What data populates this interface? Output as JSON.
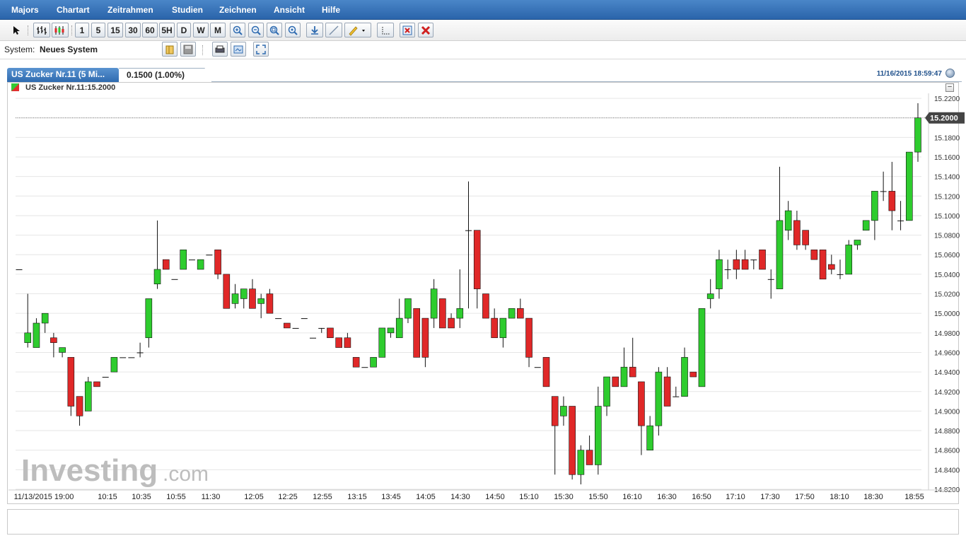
{
  "menu": {
    "items": [
      "Majors",
      "Chartart",
      "Zeitrahmen",
      "Studien",
      "Zeichnen",
      "Ansicht",
      "Hilfe"
    ]
  },
  "toolbar": {
    "timeframes": [
      "1",
      "5",
      "15",
      "30",
      "60",
      "5H",
      "D",
      "W",
      "M"
    ],
    "icons": [
      "pointer-icon",
      "bar-chart-icon",
      "candlestick-icon",
      "zoom-in-icon",
      "zoom-out-icon",
      "zoom-fit-icon",
      "zoom-reset-icon",
      "download-icon",
      "line-draw-icon",
      "pencil-icon",
      "dropdown-icon",
      "crosshair-icon",
      "remove-drawing-icon",
      "delete-icon"
    ]
  },
  "system": {
    "label": "System:",
    "value": "Neues System"
  },
  "tab": {
    "title": "US Zucker Nr.11 (5 Mi...",
    "quote": "0.1500 (1.00%)",
    "datetime": "11/16/2015 18:59:47"
  },
  "legend": "US Zucker Nr.11:15.2000",
  "watermark": {
    "main": "Investing",
    "suffix": ".com"
  },
  "colors": {
    "up": "#2ecc2e",
    "down": "#e02828",
    "accent": "#2f6bb0",
    "label_bg": "#444444"
  },
  "chart_data": {
    "type": "candlestick",
    "title": "US Zucker Nr.11",
    "interval": "5 Min",
    "last_price": "15.2000",
    "y_ticks": [
      "15.2200",
      "15.2000",
      "15.1800",
      "15.1600",
      "15.1400",
      "15.1200",
      "15.1000",
      "15.0800",
      "15.0600",
      "15.0400",
      "15.0200",
      "15.0000",
      "14.9800",
      "14.9600",
      "14.9400",
      "14.9200",
      "14.9000",
      "14.8800",
      "14.8600",
      "14.8400",
      "14.8200"
    ],
    "ylim": [
      14.82,
      15.22
    ],
    "x_ticks": [
      "11/13/2015 19:00",
      "10:15",
      "10:35",
      "10:55",
      "11:30",
      "12:05",
      "12:25",
      "12:55",
      "13:15",
      "13:45",
      "14:05",
      "14:30",
      "14:50",
      "15:10",
      "15:30",
      "15:50",
      "16:10",
      "16:30",
      "16:50",
      "17:10",
      "17:30",
      "17:50",
      "18:10",
      "18:30",
      "18:55"
    ],
    "grid": true,
    "candles": [
      [
        15.045,
        15.045,
        15.045,
        15.045
      ],
      [
        14.97,
        15.02,
        14.965,
        14.98
      ],
      [
        14.965,
        14.995,
        14.965,
        14.99
      ],
      [
        14.99,
        15.0,
        14.98,
        15.0
      ],
      [
        14.975,
        14.98,
        14.955,
        14.97
      ],
      [
        14.96,
        14.965,
        14.955,
        14.965
      ],
      [
        14.955,
        14.955,
        14.895,
        14.905
      ],
      [
        14.915,
        14.915,
        14.885,
        14.895
      ],
      [
        14.9,
        14.935,
        14.9,
        14.93
      ],
      [
        14.93,
        14.93,
        14.925,
        14.925
      ],
      [
        14.935,
        14.935,
        14.935,
        14.935
      ],
      [
        14.94,
        14.955,
        14.94,
        14.955
      ],
      [
        14.955,
        14.955,
        14.955,
        14.955
      ],
      [
        14.955,
        14.955,
        14.955,
        14.955
      ],
      [
        14.96,
        14.97,
        14.955,
        14.96
      ],
      [
        14.975,
        15.015,
        14.965,
        15.015
      ],
      [
        15.03,
        15.095,
        15.025,
        15.045
      ],
      [
        15.055,
        15.055,
        15.045,
        15.045
      ],
      [
        15.035,
        15.035,
        15.035,
        15.035
      ],
      [
        15.045,
        15.065,
        15.045,
        15.065
      ],
      [
        15.055,
        15.055,
        15.055,
        15.055
      ],
      [
        15.045,
        15.055,
        15.045,
        15.055
      ],
      [
        15.06,
        15.06,
        15.06,
        15.06
      ],
      [
        15.065,
        15.065,
        15.035,
        15.04
      ],
      [
        15.04,
        15.04,
        15.005,
        15.005
      ],
      [
        15.01,
        15.03,
        15.005,
        15.02
      ],
      [
        15.015,
        15.025,
        15.005,
        15.025
      ],
      [
        15.025,
        15.035,
        15.005,
        15.005
      ],
      [
        15.01,
        15.02,
        14.995,
        15.015
      ],
      [
        15.02,
        15.025,
        15.0,
        15.0
      ],
      [
        14.995,
        14.995,
        14.995,
        14.995
      ],
      [
        14.99,
        14.99,
        14.985,
        14.985
      ],
      [
        14.985,
        14.985,
        14.985,
        14.985
      ],
      [
        14.995,
        14.995,
        14.995,
        14.995
      ],
      [
        14.975,
        14.975,
        14.975,
        14.975
      ],
      [
        14.985,
        14.985,
        14.98,
        14.985
      ],
      [
        14.985,
        14.985,
        14.975,
        14.975
      ],
      [
        14.975,
        14.975,
        14.965,
        14.965
      ],
      [
        14.975,
        14.98,
        14.965,
        14.965
      ],
      [
        14.955,
        14.955,
        14.945,
        14.945
      ],
      [
        14.945,
        14.945,
        14.945,
        14.945
      ],
      [
        14.945,
        14.955,
        14.945,
        14.955
      ],
      [
        14.955,
        14.985,
        14.955,
        14.985
      ],
      [
        14.98,
        14.985,
        14.975,
        14.985
      ],
      [
        14.975,
        15.015,
        14.975,
        14.995
      ],
      [
        14.995,
        15.015,
        14.99,
        15.015
      ],
      [
        15.005,
        15.005,
        14.955,
        14.955
      ],
      [
        14.995,
        14.995,
        14.945,
        14.955
      ],
      [
        14.995,
        15.035,
        14.985,
        15.025
      ],
      [
        15.015,
        15.015,
        14.985,
        14.985
      ],
      [
        14.995,
        15.0,
        14.985,
        14.985
      ],
      [
        14.995,
        15.045,
        14.985,
        15.005
      ],
      [
        15.085,
        15.135,
        15.005,
        15.085
      ],
      [
        15.085,
        15.085,
        15.005,
        15.025
      ],
      [
        15.02,
        15.02,
        14.995,
        14.995
      ],
      [
        14.995,
        15.005,
        14.975,
        14.975
      ],
      [
        14.975,
        14.995,
        14.965,
        14.995
      ],
      [
        14.995,
        15.005,
        14.995,
        15.005
      ],
      [
        15.005,
        15.015,
        14.995,
        14.995
      ],
      [
        14.995,
        14.995,
        14.945,
        14.955
      ],
      [
        14.945,
        14.945,
        14.945,
        14.945
      ],
      [
        14.955,
        14.955,
        14.925,
        14.925
      ],
      [
        14.915,
        14.915,
        14.835,
        14.885
      ],
      [
        14.895,
        14.915,
        14.885,
        14.905
      ],
      [
        14.905,
        14.905,
        14.83,
        14.835
      ],
      [
        14.835,
        14.865,
        14.825,
        14.86
      ],
      [
        14.86,
        14.875,
        14.845,
        14.845
      ],
      [
        14.845,
        14.925,
        14.835,
        14.905
      ],
      [
        14.905,
        14.935,
        14.895,
        14.935
      ],
      [
        14.935,
        14.935,
        14.925,
        14.925
      ],
      [
        14.925,
        14.965,
        14.925,
        14.945
      ],
      [
        14.945,
        14.975,
        14.935,
        14.935
      ],
      [
        14.93,
        14.93,
        14.855,
        14.885
      ],
      [
        14.86,
        14.895,
        14.86,
        14.885
      ],
      [
        14.885,
        14.945,
        14.875,
        14.94
      ],
      [
        14.935,
        14.945,
        14.905,
        14.905
      ],
      [
        14.915,
        14.925,
        14.915,
        14.915
      ],
      [
        14.915,
        14.965,
        14.915,
        14.955
      ],
      [
        14.94,
        14.94,
        14.935,
        14.935
      ],
      [
        14.925,
        14.925,
        14.925,
        15.005
      ],
      [
        15.015,
        15.035,
        15.005,
        15.02
      ],
      [
        15.025,
        15.065,
        15.015,
        15.055
      ],
      [
        15.045,
        15.055,
        15.035,
        15.045
      ],
      [
        15.055,
        15.065,
        15.035,
        15.045
      ],
      [
        15.055,
        15.065,
        15.045,
        15.045
      ],
      [
        15.055,
        15.055,
        15.045,
        15.055
      ],
      [
        15.065,
        15.065,
        15.045,
        15.045
      ],
      [
        15.035,
        15.045,
        15.015,
        15.035
      ],
      [
        15.025,
        15.15,
        15.025,
        15.095
      ],
      [
        15.085,
        15.115,
        15.075,
        15.105
      ],
      [
        15.095,
        15.105,
        15.065,
        15.07
      ],
      [
        15.085,
        15.085,
        15.065,
        15.07
      ],
      [
        15.065,
        15.065,
        15.055,
        15.055
      ],
      [
        15.065,
        15.065,
        15.035,
        15.035
      ],
      [
        15.05,
        15.06,
        15.04,
        15.045
      ],
      [
        15.04,
        15.055,
        15.035,
        15.04
      ],
      [
        15.04,
        15.075,
        15.04,
        15.07
      ],
      [
        15.07,
        15.075,
        15.065,
        15.075
      ],
      [
        15.085,
        15.095,
        15.085,
        15.095
      ],
      [
        15.095,
        15.125,
        15.075,
        15.125
      ],
      [
        15.125,
        15.145,
        15.115,
        15.125
      ],
      [
        15.125,
        15.155,
        15.085,
        15.105
      ],
      [
        15.095,
        15.115,
        15.085,
        15.095
      ],
      [
        15.095,
        15.165,
        15.095,
        15.165
      ],
      [
        15.165,
        15.215,
        15.155,
        15.2
      ]
    ]
  }
}
